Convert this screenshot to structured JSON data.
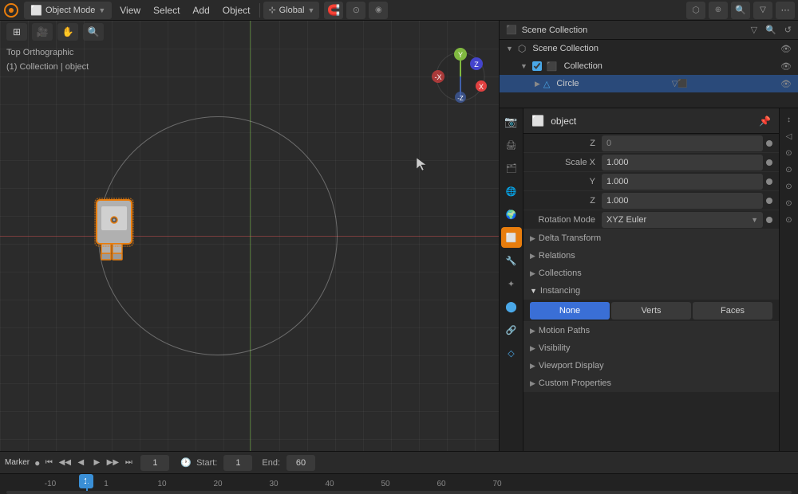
{
  "app": {
    "title": "Blender"
  },
  "top_menu": {
    "mode": "Object Mode",
    "items": [
      "View",
      "Select",
      "Add",
      "Object"
    ],
    "transform_orientation": "Global",
    "snapping": "Snap",
    "icons_right": [
      "search"
    ]
  },
  "viewport": {
    "label_top": "Top Orthographic",
    "label_collection": "(1) Collection | object",
    "nav_axes": {
      "y": "Y",
      "z": "Z",
      "x": "X"
    }
  },
  "timeline": {
    "marker_label": "Marker",
    "current_frame": "1",
    "start_label": "Start:",
    "start_value": "1",
    "end_label": "End:",
    "end_value": "60",
    "playback_dot": "●"
  },
  "scrubber": {
    "ticks": [
      "-10",
      "1",
      "10",
      "20",
      "30",
      "40",
      "50",
      "60",
      "70"
    ],
    "current_frame_display": "1"
  },
  "outliner": {
    "header_title": "Scene Collection",
    "items": [
      {
        "id": "scene-collection",
        "label": "Scene Collection",
        "indent": 0,
        "type": "scene",
        "expanded": true,
        "visible": true
      },
      {
        "id": "collection",
        "label": "Collection",
        "indent": 1,
        "type": "collection",
        "expanded": true,
        "visible": true
      },
      {
        "id": "circle",
        "label": "Circle",
        "indent": 2,
        "type": "mesh",
        "expanded": false,
        "visible": true
      }
    ]
  },
  "properties": {
    "object_name": "object",
    "tabs": [
      {
        "id": "scene",
        "icon": "🎬",
        "active": false
      },
      {
        "id": "render",
        "icon": "📷",
        "active": false
      },
      {
        "id": "output",
        "icon": "🖨",
        "active": false
      },
      {
        "id": "view_layer",
        "icon": "🗂",
        "active": false
      },
      {
        "id": "scene2",
        "icon": "🌐",
        "active": false
      },
      {
        "id": "world",
        "icon": "🌍",
        "active": false
      },
      {
        "id": "object",
        "icon": "⬜",
        "active": true
      },
      {
        "id": "modifier",
        "icon": "🔧",
        "active": false
      },
      {
        "id": "particles",
        "icon": "✦",
        "active": false
      },
      {
        "id": "physics",
        "icon": "🔵",
        "active": false
      },
      {
        "id": "constraints",
        "icon": "🔗",
        "active": false
      },
      {
        "id": "data",
        "icon": "🔷",
        "active": false
      }
    ],
    "transform": {
      "scale_x_label": "Scale X",
      "scale_x_value": "1.000",
      "y_label": "Y",
      "y_value": "1.000",
      "z_label": "Z",
      "z_value": "1.000",
      "rotation_mode_label": "Rotation Mode",
      "rotation_mode_value": "XYZ Euler"
    },
    "sections": [
      {
        "id": "delta-transform",
        "label": "Delta Transform",
        "expanded": false
      },
      {
        "id": "relations",
        "label": "Relations",
        "expanded": false
      },
      {
        "id": "collections",
        "label": "Collections",
        "expanded": false
      },
      {
        "id": "instancing",
        "label": "Instancing",
        "expanded": true
      },
      {
        "id": "motion-paths",
        "label": "Motion Paths",
        "expanded": false
      },
      {
        "id": "visibility",
        "label": "Visibility",
        "expanded": false
      },
      {
        "id": "viewport-display",
        "label": "Viewport Display",
        "expanded": false
      },
      {
        "id": "custom-properties",
        "label": "Custom Properties",
        "expanded": false
      }
    ],
    "instancing": {
      "buttons": [
        {
          "id": "none",
          "label": "None",
          "active": true
        },
        {
          "id": "verts",
          "label": "Verts",
          "active": false
        },
        {
          "id": "faces",
          "label": "Faces",
          "active": false
        }
      ]
    }
  }
}
